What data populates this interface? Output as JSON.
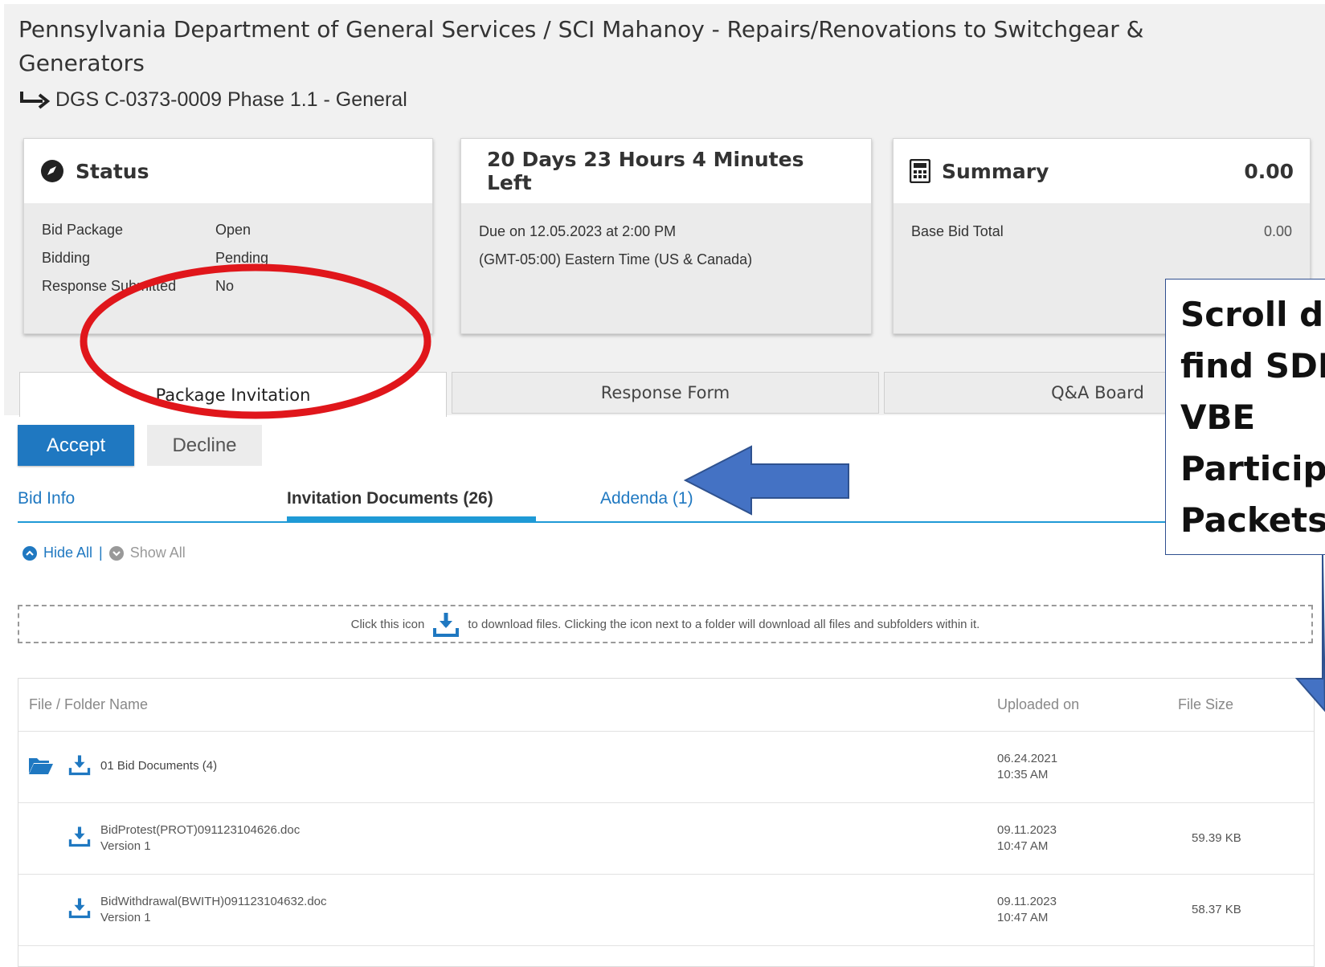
{
  "header": {
    "title": "Pennsylvania Department of General Services / SCI Mahanoy - Repairs/Renovations to Switchgear & Generators",
    "subtitle": "DGS C-0373-0009 Phase 1.1 - General"
  },
  "cards": {
    "status": {
      "title": "Status",
      "rows": [
        {
          "label": "Bid Package",
          "value": "Open"
        },
        {
          "label": "Bidding",
          "value": "Pending"
        },
        {
          "label": "Response Submitted",
          "value": "No"
        }
      ]
    },
    "time": {
      "title": "20 Days 23 Hours 4 Minutes Left",
      "due": "Due on 12.05.2023 at 2:00 PM",
      "timezone": "(GMT-05:00) Eastern Time (US & Canada)"
    },
    "summary": {
      "title": "Summary",
      "total": "0.00",
      "row_label": "Base Bid Total",
      "row_value": "0.00"
    }
  },
  "tabs": [
    "Package Invitation",
    "Response Form",
    "Q&A Board"
  ],
  "actions": {
    "accept": "Accept",
    "decline": "Decline"
  },
  "subtabs": [
    "Bid Info",
    "Invitation Documents (26)",
    "Addenda (1)"
  ],
  "toggles": {
    "hide": "Hide All",
    "separator": "|",
    "show": "Show All"
  },
  "hint": {
    "before": "Click this icon",
    "after": "to download files. Clicking the icon next to a folder will download all files and subfolders within it."
  },
  "files": {
    "columns": [
      "File / Folder Name",
      "Uploaded on",
      "File Size"
    ],
    "rows": [
      {
        "name": "01 Bid Documents (4)",
        "version": "",
        "date": "06.24.2021",
        "time": "10:35 AM",
        "size": ""
      },
      {
        "name": "BidProtest(PROT)091123104626.doc",
        "version": "Version 1",
        "date": "09.11.2023",
        "time": "10:47 AM",
        "size": "59.39 KB"
      },
      {
        "name": "BidWithdrawal(BWITH)091123104632.doc",
        "version": "Version 1",
        "date": "09.11.2023",
        "time": "10:47 AM",
        "size": "58.37 KB"
      }
    ]
  },
  "annotation": {
    "lines": [
      "Scroll do",
      "find SDB",
      "VBE",
      "Participa",
      "Packets"
    ]
  },
  "colors": {
    "accent": "#1f78c1",
    "underline": "#1f9ad6",
    "annotation_red": "#e0161b",
    "annotation_blue": "#4472c4"
  },
  "icons": [
    "compass-icon",
    "calculator-icon",
    "return-arrow-icon",
    "download-icon",
    "folder-open-icon",
    "chevron-up-circle-icon",
    "chevron-down-circle-icon"
  ]
}
